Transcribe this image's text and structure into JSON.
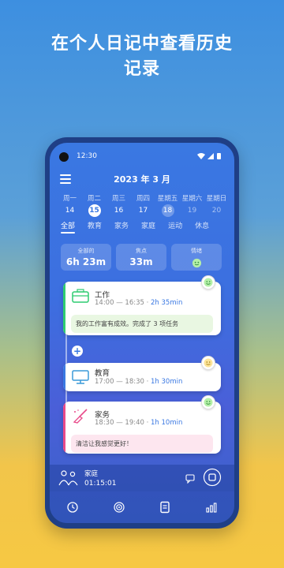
{
  "headline": {
    "line1": "在个人日记中查看历史",
    "line2": "记录"
  },
  "status": {
    "time": "12:30"
  },
  "header": {
    "month": "2023 年 3 月"
  },
  "week": {
    "days": [
      {
        "label": "周一",
        "num": "14"
      },
      {
        "label": "周二",
        "num": "15"
      },
      {
        "label": "周三",
        "num": "16"
      },
      {
        "label": "周四",
        "num": "17"
      },
      {
        "label": "星期五",
        "num": "18"
      },
      {
        "label": "星期六",
        "num": "19"
      },
      {
        "label": "星期日",
        "num": "20"
      }
    ]
  },
  "filters": [
    "全部",
    "教育",
    "家务",
    "家庭",
    "运动",
    "休息"
  ],
  "stats": {
    "total_label": "全部的",
    "total_value": "6h 23m",
    "focus_label": "焦点",
    "focus_value": "33m",
    "mood_label": "情绪"
  },
  "cards": [
    {
      "title": "工作",
      "start": "14:00",
      "end": "16:35",
      "duration": "2h 35min",
      "note": "我的工作富有成效。完成了 3 项任务"
    },
    {
      "title": "教育",
      "start": "17:00",
      "end": "18:30",
      "duration": "1h 30min"
    },
    {
      "title": "家务",
      "start": "18:30",
      "end": "19:40",
      "duration": "1h 10min",
      "note": "清洁让我感觉更好！"
    }
  ],
  "player": {
    "category": "家庭",
    "elapsed": "01:15:01"
  },
  "colors": {
    "work": "#2ecc71",
    "education": "#3a78e2",
    "chores": "#e84a8a"
  }
}
